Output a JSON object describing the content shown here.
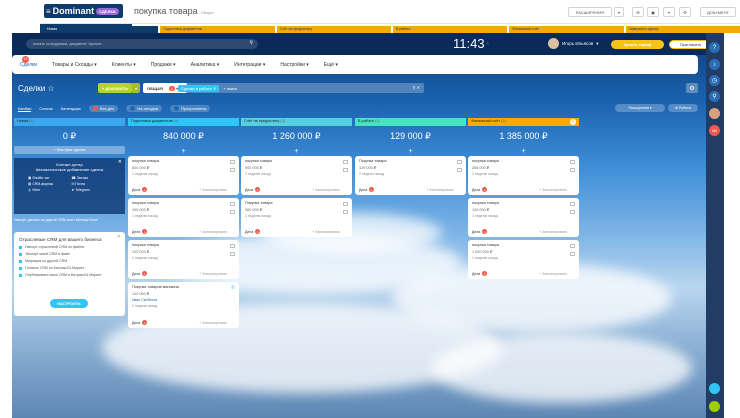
{
  "background": {
    "portal": "Dominant",
    "portal_badge": "СДЕЛКИ",
    "sub_menu": "Совместная работа",
    "title": "покупка товара",
    "title_small": "Общее",
    "buttons": [
      "РАСШИРЕНИЯ",
      "ДОКУМЕНТ"
    ],
    "stages": [
      "Новая",
      "Подготовка документов",
      "Счёт на предоплату",
      "В работе",
      "Финальный счёт",
      "Завершить сделку"
    ]
  },
  "header": {
    "search_placeholder": "искать сотрудника, документ, прочее...",
    "clock": "11:43",
    "clock_suffix": "⁘",
    "user_name": "Игорь Ильясов",
    "buy_label": "Купить тариф",
    "invite_label": "Пригласить"
  },
  "nav": {
    "items": [
      "Сделки",
      "Товары и Склады",
      "Клиенты",
      "Продажи",
      "Аналитика",
      "Интеграции",
      "Настройки",
      "Ещё"
    ],
    "badge": "13"
  },
  "toolbar": {
    "title": "Сделки",
    "add_label": "ДОБАВИТЬ",
    "category_label": "ОБЩАЯ",
    "category_badge": "1",
    "filter_tag": "Сделки в работе",
    "filter_placeholder": "+ поиск"
  },
  "views": {
    "tabs": [
      "Канбан",
      "Список",
      "Календарь"
    ],
    "pills": [
      {
        "label": "Без дел",
        "color": "#f05a4a"
      },
      {
        "label": "На сегодня",
        "color": "#2067b0"
      },
      {
        "label": "Просроченны",
        "color": "#2067b0"
      }
    ],
    "sort_label": "Расширения",
    "robots_label": "Роботы"
  },
  "columns": [
    {
      "name": "Новая",
      "count": "(1)",
      "sum": "0 ₽",
      "color": "#39a8ef"
    },
    {
      "name": "Подготовка документов",
      "count": "(3)",
      "sum": "840 000 ₽",
      "color": "#2fc6f6"
    },
    {
      "name": "Счёт на предоплату",
      "count": "(2)",
      "sum": "1 260 000 ₽",
      "color": "#55d0e0"
    },
    {
      "name": "В работе",
      "count": "(1)",
      "sum": "129 000 ₽",
      "color": "#47e4c2"
    },
    {
      "name": "Финальный счёт",
      "count": "(3)",
      "sum": "1 385 000 ₽",
      "color": "#ffa900"
    }
  ],
  "new_column": {
    "add_label": "Быстрая сделка",
    "contact_title": "Контакт-центр\nАвтоматическое добавление сделок",
    "contact_items": [
      "Shuttle чат",
      "Звонки",
      "CRM-формы",
      "Почта",
      "Viber",
      "Telegram"
    ],
    "import_text": "Импорт данных из другой CRM или таблицы Excel",
    "crm_title": "Отраслевые CRM для вашего бизнеса",
    "crm_items": [
      "Импорт отраслевой CRM из файла",
      "Экспорт моей CRM в файл",
      "Миграция из другой CRM",
      "Готовые CRM из Битрикс24.Маркет",
      "Опубликовать свою CRM в Битрикс24.Маркет"
    ],
    "crm_button": "НАСТРОИТЬ"
  },
  "cards": {
    "col1": [
      {
        "title": "покупка товара",
        "price": "600 000 ₽",
        "date": "1 неделю назад",
        "deal": "Дела",
        "status": "+ Запланировать"
      },
      {
        "title": "покупка товара",
        "price": "100 000 ₽",
        "date": "1 неделю назад",
        "deal": "Дела",
        "status": "+ Запланировать"
      },
      {
        "title": "покупка товара",
        "price": "120 000 ₽",
        "date": "1 неделю назад",
        "deal": "Дела",
        "status": "+ Запланировать"
      },
      {
        "title": "Покупка товаров магазина",
        "price": "120 000 ₽",
        "contact": "Иван Скобёлов",
        "date": "2 недели назад",
        "deal": "Дела",
        "status": "+ Запланировать"
      }
    ],
    "col2": [
      {
        "title": "покупка товара",
        "price": "900 000 ₽",
        "date": "1 неделю назад",
        "deal": "Дела",
        "status": "+ Запланировать"
      },
      {
        "title": "Покупка товара",
        "price": "360 000 ₽",
        "date": "1 неделю назад",
        "deal": "Дела",
        "status": "+ Запланировать"
      }
    ],
    "col3": [
      {
        "title": "Покупка товара",
        "price": "129 000 ₽",
        "date": "2 недели назад",
        "deal": "Дела",
        "status": "+ Запланировать"
      }
    ],
    "col4": [
      {
        "title": "покупка товара",
        "price": "265 000 ₽",
        "date": "1 неделю назад",
        "deal": "Дела",
        "status": "+ Запланировать"
      },
      {
        "title": "покупка товара",
        "price": "120 000 ₽",
        "date": "1 неделю назад",
        "deal": "Дела",
        "status": "+ Запланировать"
      },
      {
        "title": "покупка товара",
        "price": "1 000 000 ₽",
        "date": "1 неделю назад",
        "deal": "Дела",
        "status": "+ Запланировать"
      }
    ]
  }
}
